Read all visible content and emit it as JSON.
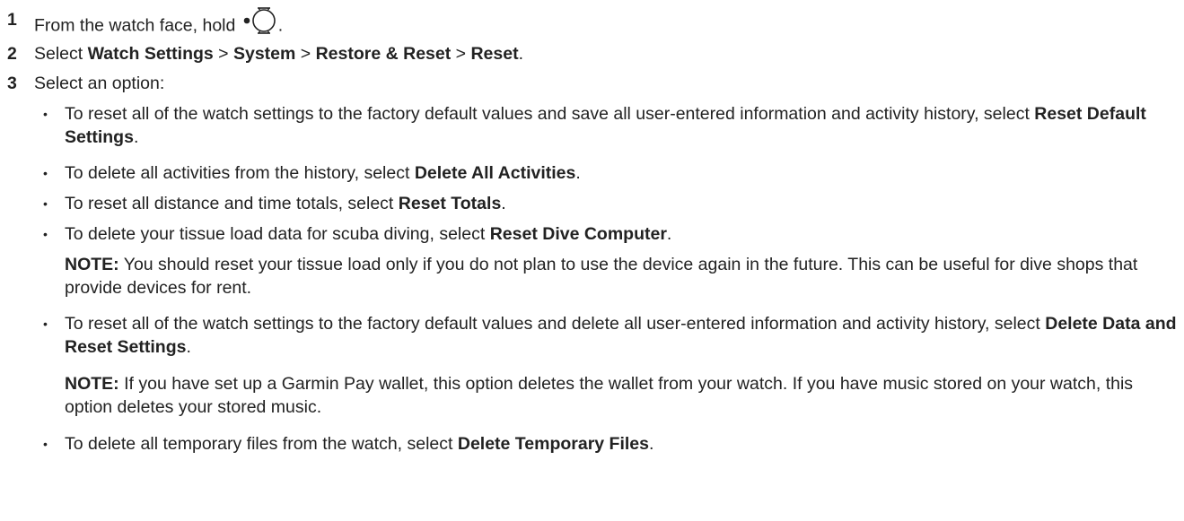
{
  "steps": [
    {
      "num": "1",
      "text_before": "From the watch face, hold ",
      "icon": "watch-button-icon",
      "text_after": "."
    },
    {
      "num": "2",
      "parts": [
        "Select ",
        "Watch Settings",
        " > ",
        "System",
        " > ",
        "Restore & Reset",
        " > ",
        "Reset",
        "."
      ]
    },
    {
      "num": "3",
      "text": "Select an option:"
    }
  ],
  "options": [
    {
      "text": "To reset all of the watch settings to the factory default values and save all user-entered information and activity history, select ",
      "bold": "Reset Default Settings",
      "end": "."
    },
    {
      "text": "To delete all activities from the history, select ",
      "bold": "Delete All Activities",
      "end": "."
    },
    {
      "text": "To reset all distance and time totals, select ",
      "bold": "Reset Totals",
      "end": "."
    },
    {
      "text": "To delete your tissue load data for scuba diving, select ",
      "bold": "Reset Dive Computer",
      "end": "."
    },
    {
      "text": "To reset all of the watch settings to the factory default values and delete all user-entered information and activity history, select ",
      "bold": "Delete Data and Reset Settings",
      "end": "."
    },
    {
      "text": "To delete all temporary files from the watch, select ",
      "bold": "Delete Temporary Files",
      "end": "."
    }
  ],
  "notes": [
    {
      "label": "NOTE:",
      "text": " You should reset your tissue load only if you do not plan to use the device again in the future. This can be useful for dive shops that provide devices for rent."
    },
    {
      "label": "NOTE:",
      "text": " If you have set up a Garmin Pay wallet, this option deletes the wallet from your watch. If you have music stored on your watch, this option deletes your stored music."
    }
  ],
  "bullet_char": "•"
}
